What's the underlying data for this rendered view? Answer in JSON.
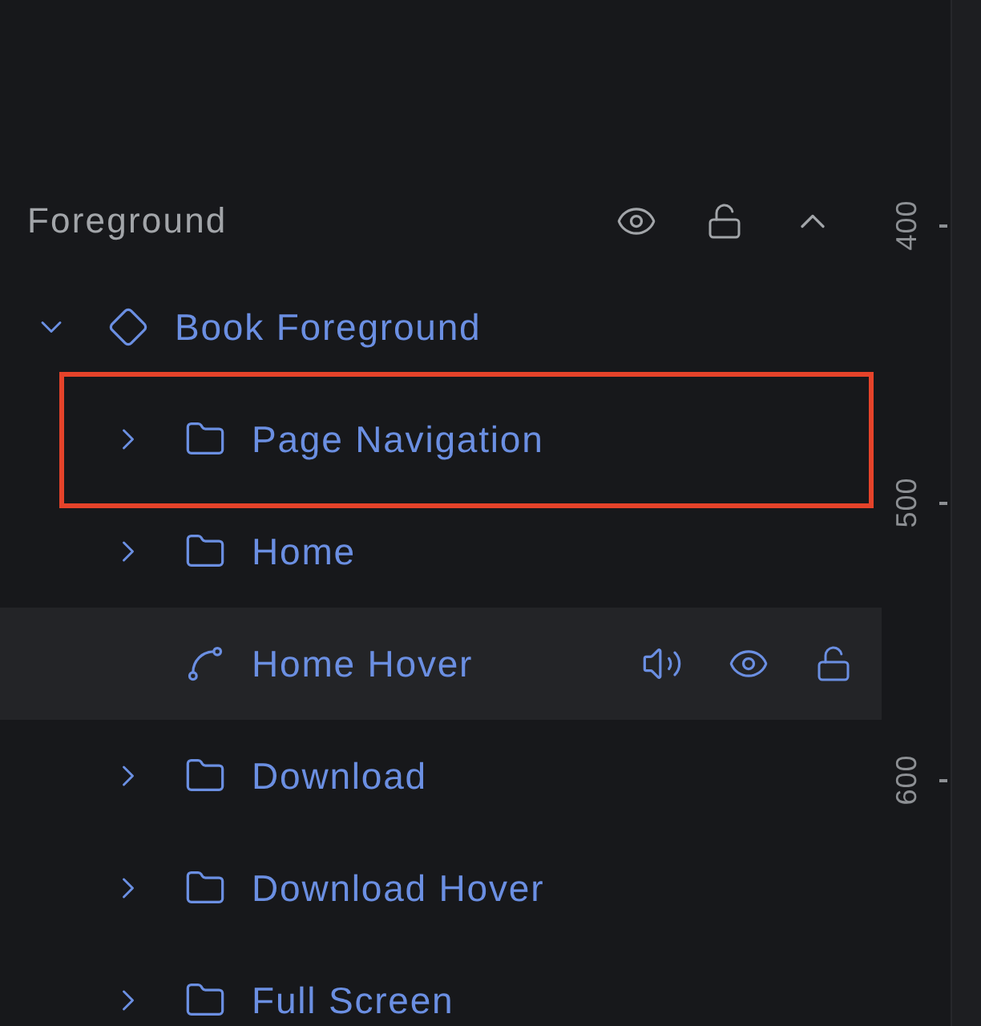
{
  "panel": {
    "title": "Foreground",
    "visible": true,
    "locked": false,
    "expanded": true
  },
  "layers": [
    {
      "label": "Book Foreground",
      "kind": "component",
      "expanded": true,
      "hovered": false,
      "highlighted": false,
      "children": [
        {
          "label": "Page Navigation",
          "kind": "folder",
          "expanded": false,
          "hovered": false,
          "highlighted": true
        },
        {
          "label": "Home",
          "kind": "folder",
          "expanded": false,
          "hovered": false,
          "highlighted": false
        },
        {
          "label": "Home Hover",
          "kind": "path",
          "hovered": true,
          "highlighted": false
        },
        {
          "label": "Download",
          "kind": "folder",
          "expanded": false,
          "hovered": false,
          "highlighted": false
        },
        {
          "label": "Download Hover",
          "kind": "folder",
          "expanded": false,
          "hovered": false,
          "highlighted": false
        },
        {
          "label": "Full Screen",
          "kind": "folder",
          "expanded": false,
          "hovered": false,
          "highlighted": false
        }
      ]
    }
  ],
  "ruler": {
    "labels": [
      "400",
      "500",
      "600"
    ]
  }
}
